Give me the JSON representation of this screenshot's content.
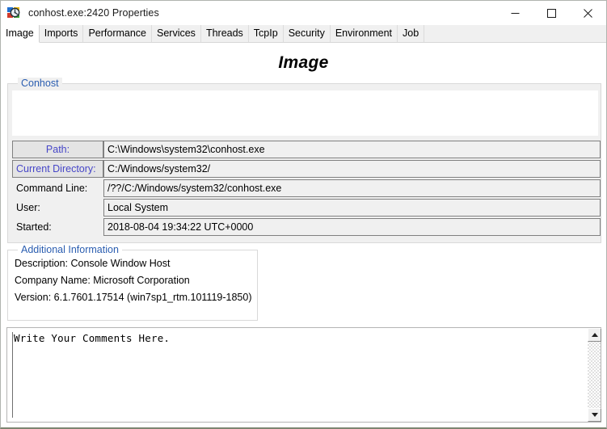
{
  "window": {
    "title": "conhost.exe:2420 Properties",
    "icon": "process-explorer-icon",
    "buttons": {
      "minimize": "minimize-icon",
      "maximize": "maximize-icon",
      "close": "close-icon"
    }
  },
  "tabs": [
    {
      "label": "Image",
      "active": true
    },
    {
      "label": "Imports",
      "active": false
    },
    {
      "label": "Performance",
      "active": false
    },
    {
      "label": "Services",
      "active": false
    },
    {
      "label": "Threads",
      "active": false
    },
    {
      "label": "TcpIp",
      "active": false
    },
    {
      "label": "Security",
      "active": false
    },
    {
      "label": "Environment",
      "active": false
    },
    {
      "label": "Job",
      "active": false
    }
  ],
  "page": {
    "title": "Image",
    "conhost_group": {
      "legend": "Conhost"
    },
    "fields": [
      {
        "label": "Path:",
        "value": "C:\\Windows\\system32\\conhost.exe",
        "style": "boxed-center-link"
      },
      {
        "label": "Current Directory:",
        "value": "C:/Windows/system32/",
        "style": "boxed-left-link"
      },
      {
        "label": "Command Line:",
        "value": "/??/C:/Windows/system32/conhost.exe",
        "style": "plain"
      },
      {
        "label": "User:",
        "value": "Local System",
        "style": "plain"
      },
      {
        "label": "Started:",
        "value": "2018-08-04 19:34:22 UTC+0000",
        "style": "plain"
      }
    ],
    "additional_information": {
      "legend": "Additional Information",
      "lines": [
        "Description: Console Window Host",
        "Company Name: Microsoft Corporation",
        "Version: 6.1.7601.17514 (win7sp1_rtm.101119-1850)"
      ]
    },
    "comments": {
      "value": "Write Your Comments Here.",
      "scrollbar": {
        "up": "scroll-up-icon",
        "down": "scroll-down-icon"
      }
    }
  },
  "colors": {
    "link_blue": "#2a5db0",
    "label_violet": "#4646c8",
    "field_bg": "#f0f0f0",
    "field_border": "#808080",
    "window_border": "#b0b4ae",
    "window_bottom": "#7d8571"
  }
}
